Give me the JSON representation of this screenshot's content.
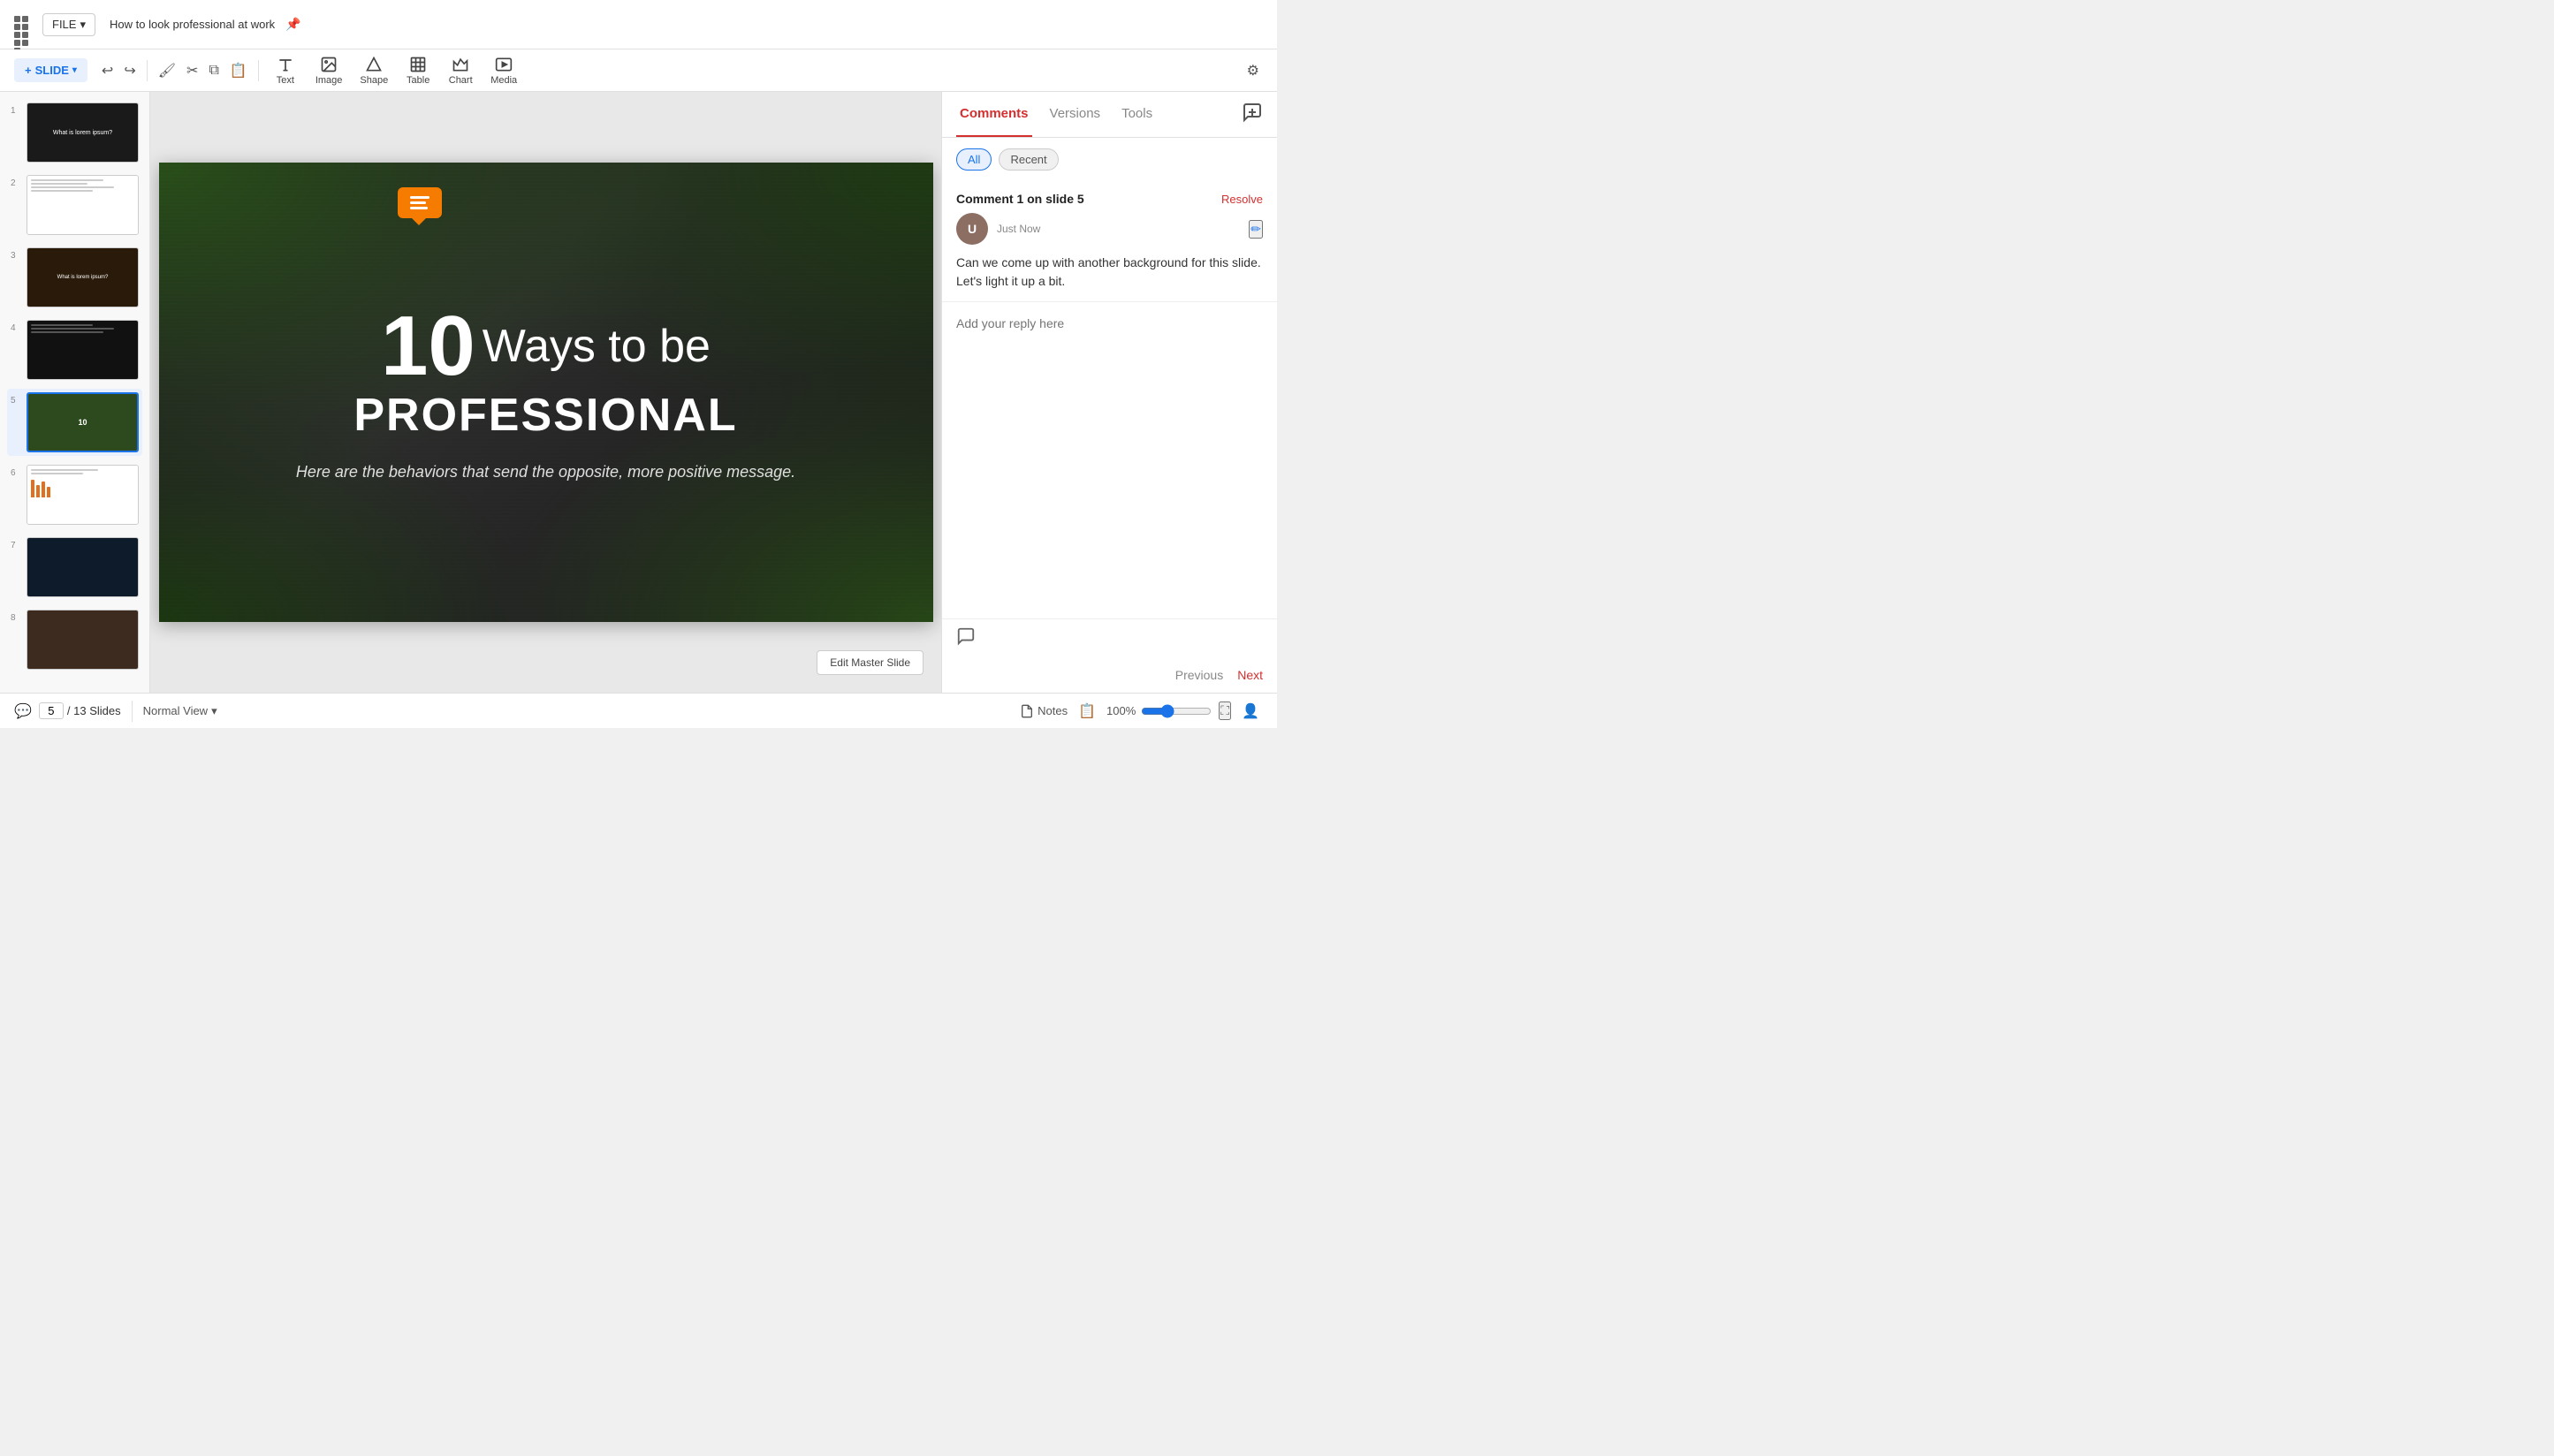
{
  "app": {
    "file_label": "FILE",
    "file_chevron": "▾",
    "presentation_title": "How to look professional at work",
    "save_icon": "🔖"
  },
  "toolbar": {
    "slide_btn_label": "SLIDE",
    "slide_chevron": "▾",
    "undo_label": "↩",
    "redo_label": "↪",
    "paint_label": "🖌",
    "scissors_label": "✂",
    "copy_label": "⧉",
    "clipboard_label": "📋",
    "gear_label": "⚙",
    "tools": [
      {
        "id": "text",
        "label": "Text"
      },
      {
        "id": "image",
        "label": "Image"
      },
      {
        "id": "shape",
        "label": "Shape"
      },
      {
        "id": "table",
        "label": "Table"
      },
      {
        "id": "chart",
        "label": "Chart"
      },
      {
        "id": "media",
        "label": "Media"
      }
    ]
  },
  "slide": {
    "big_number": "10",
    "ways_text": "Ways to be",
    "professional": "PROFESSIONAL",
    "subtitle": "Here are the behaviors that send the opposite, more positive message."
  },
  "bottom_bar": {
    "current_page": "5",
    "total_slides": "/ 13 Slides",
    "view_label": "Normal View",
    "notes_label": "Notes",
    "zoom_level": "100%",
    "edit_master": "Edit Master Slide"
  },
  "right_panel": {
    "tabs": [
      "Comments",
      "Versions",
      "Tools"
    ],
    "active_tab": "Comments",
    "filter_all": "All",
    "filter_recent": "Recent",
    "add_comment_icon": "add-comment",
    "comment": {
      "title": "Comment 1 on slide 5",
      "resolve_label": "Resolve",
      "timestamp": "Just Now",
      "body": "Can we come up with another background for this slide. Let's light it up a bit.",
      "reply_placeholder": "Add your reply here"
    },
    "prev_label": "Previous",
    "next_label": "Next"
  },
  "slides_panel": {
    "slides": [
      1,
      2,
      3,
      4,
      5,
      6,
      7,
      8
    ]
  }
}
